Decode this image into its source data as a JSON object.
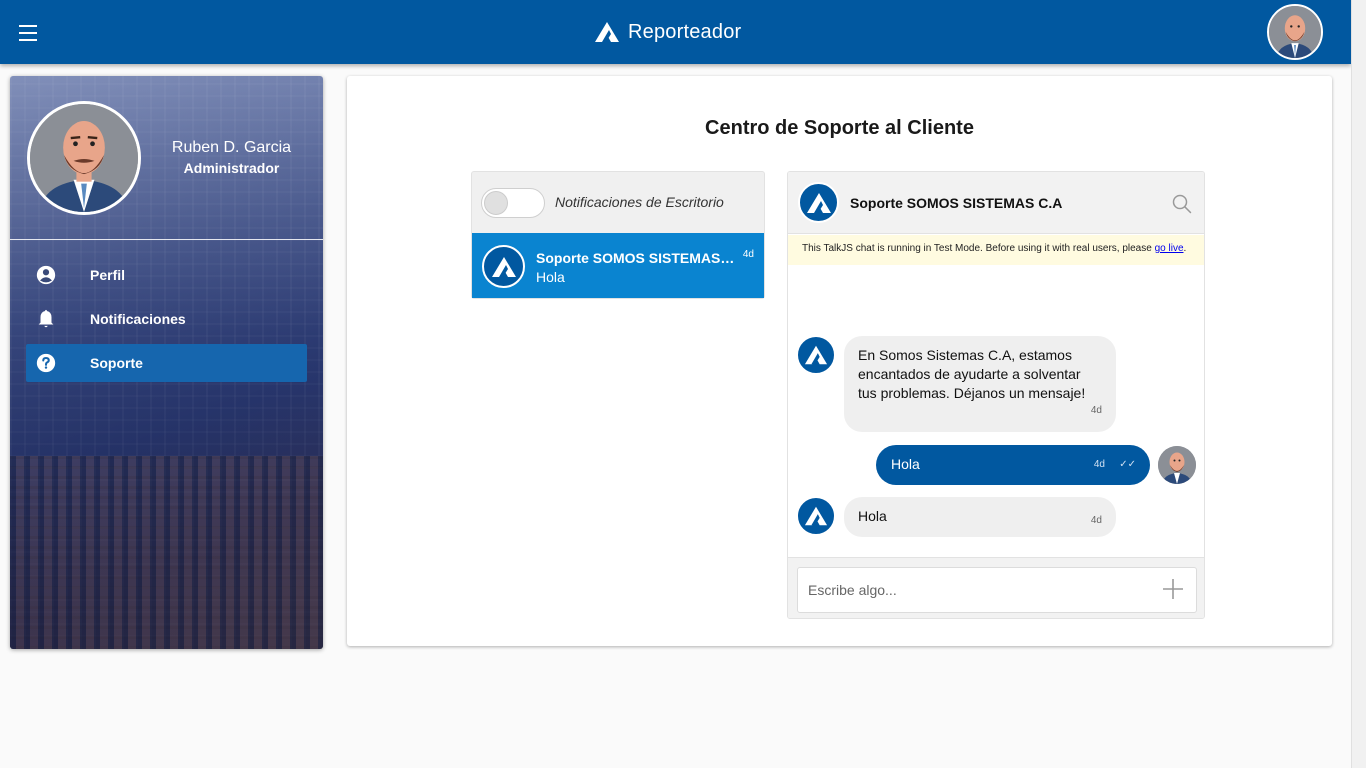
{
  "topbar": {
    "title": "Reporteador",
    "menu_icon": "hamburger-menu-icon",
    "logo_icon": "reporteador-logo-icon",
    "bg_color": "#0158a0"
  },
  "sidebar": {
    "user_name": "Ruben D. Garcia",
    "user_role": "Administrador",
    "items": [
      {
        "label": "Perfil",
        "icon": "account-circle-icon",
        "active": false
      },
      {
        "label": "Notificaciones",
        "icon": "bell-icon",
        "active": false
      },
      {
        "label": "Soporte",
        "icon": "help-circle-icon",
        "active": true
      }
    ],
    "active_color": "#1666ae"
  },
  "main": {
    "title": "Centro de Soporte al Cliente"
  },
  "inbox": {
    "notifications_label": "Notificaciones de Escritorio",
    "notifications_enabled": false,
    "conversation": {
      "name": "Soporte SOMOS SISTEMAS C.A",
      "time": "4d",
      "last_message": "Hola",
      "bg_color": "#0a84d0"
    }
  },
  "chat": {
    "header_title": "Soporte SOMOS SISTEMAS C.A",
    "test_mode_text": "This TalkJS chat is running in Test Mode. Before using it with real users, please ",
    "test_mode_link": "go live",
    "test_mode_end": ".",
    "messages": [
      {
        "from": "support",
        "text": "En Somos Sistemas C.A, estamos encantados de ayudarte a solventar tus problemas. Déjanos un mensaje!",
        "time": "4d"
      },
      {
        "from": "me",
        "text": "Hola",
        "time": "4d",
        "status": "✓✓"
      },
      {
        "from": "support",
        "text": "Hola",
        "time": "4d"
      }
    ],
    "composer_placeholder": "Escribe algo...",
    "out_bubble_color": "#0158a0",
    "in_bubble_color": "#efefef"
  }
}
